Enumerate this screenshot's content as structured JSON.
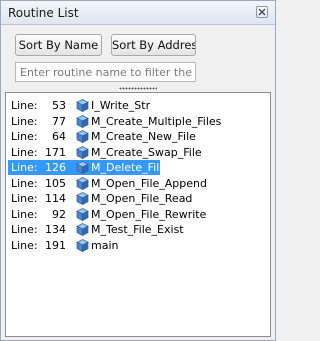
{
  "window": {
    "title": "Routine List"
  },
  "toolbar": {
    "sort_by_name_label": "Sort By Name",
    "sort_by_address_label": "Sort By Address"
  },
  "filter": {
    "placeholder": "Enter routine name to filter the list",
    "value": ""
  },
  "routines": [
    {
      "prefix": "Line:",
      "line": "53",
      "name": "I_Write_Str",
      "selected": false
    },
    {
      "prefix": "Line:",
      "line": "77",
      "name": "M_Create_Multiple_Files",
      "selected": false
    },
    {
      "prefix": "Line:",
      "line": "64",
      "name": "M_Create_New_File",
      "selected": false
    },
    {
      "prefix": "Line:",
      "line": "171",
      "name": "M_Create_Swap_File",
      "selected": false
    },
    {
      "prefix": "Line:",
      "line": "126",
      "name": "M_Delete_File",
      "selected": true
    },
    {
      "prefix": "Line:",
      "line": "105",
      "name": "M_Open_File_Append",
      "selected": false
    },
    {
      "prefix": "Line:",
      "line": "114",
      "name": "M_Open_File_Read",
      "selected": false
    },
    {
      "prefix": "Line:",
      "line": "92",
      "name": "M_Open_File_Rewrite",
      "selected": false
    },
    {
      "prefix": "Line:",
      "line": "134",
      "name": "M_Test_File_Exist",
      "selected": false
    },
    {
      "prefix": "Line:",
      "line": "191",
      "name": "main",
      "selected": false
    }
  ],
  "icons": {
    "close": "close-icon",
    "routine": "routine-icon",
    "grip": "splitter-grip-icon"
  },
  "colors": {
    "selection": "#3399ff",
    "icon_blue": "#4a86c8"
  }
}
